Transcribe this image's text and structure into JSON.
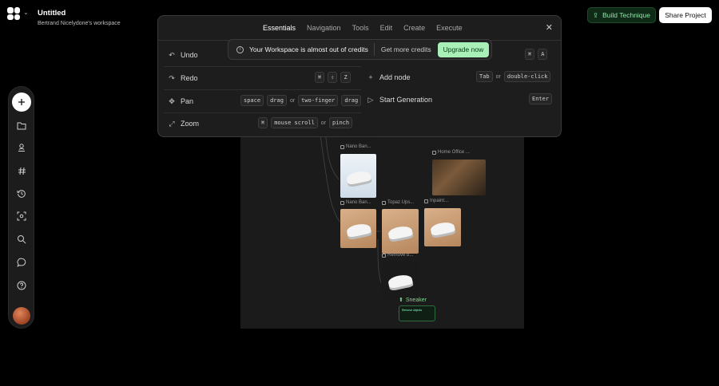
{
  "project": {
    "title": "Untitled",
    "workspace": "Bertrand Nicelydone's workspace"
  },
  "header_right": {
    "build_label": "Build Technique",
    "share_label": "Share Project"
  },
  "colors": {
    "accent_green": "#a8f0b8",
    "background": "#000000",
    "panel": "#1d1d1d"
  },
  "toolbar": {
    "icons": [
      "plus-icon",
      "folder-icon",
      "user-stack-icon",
      "hash-icon",
      "history-icon",
      "scan-face-icon",
      "search-icon",
      "chat-icon",
      "help-icon",
      "avatar"
    ]
  },
  "shortcuts_modal": {
    "tabs": [
      "Essentials",
      "Navigation",
      "Tools",
      "Edit",
      "Create",
      "Execute"
    ],
    "active_tab": "Essentials",
    "left": [
      {
        "label": "Undo",
        "keys": [
          "⌘",
          "A"
        ]
      },
      {
        "label": "Redo",
        "keys": [
          "⌘",
          "⇧",
          "Z"
        ]
      },
      {
        "label": "Pan",
        "keys": [
          "space",
          "drag"
        ],
        "alt_keys": [
          "two-finger",
          "drag"
        ],
        "or": "or"
      },
      {
        "label": "Zoom",
        "keys": [
          "⌘",
          "mouse scroll"
        ],
        "alt_keys": [
          "pinch"
        ],
        "or": "or"
      }
    ],
    "right": [
      {
        "label": "Add node",
        "keys": [
          "Tab"
        ],
        "alt_keys": [
          "double-click"
        ],
        "or": "or"
      },
      {
        "label": "Start Generation",
        "keys": [
          "Enter"
        ]
      }
    ]
  },
  "credits_banner": {
    "message": "Your Workspace is almost out of credits",
    "more_label": "Get more credits",
    "upgrade_label": "Upgrade now"
  },
  "canvas": {
    "nodes": [
      "Nano Ban...",
      "Home Office ...",
      "Nano Ban...",
      "Topaz Ups...",
      "Inpaint...",
      "Remove b..."
    ],
    "output_label": "Sneaker",
    "output_card_text": "Remove objects"
  }
}
